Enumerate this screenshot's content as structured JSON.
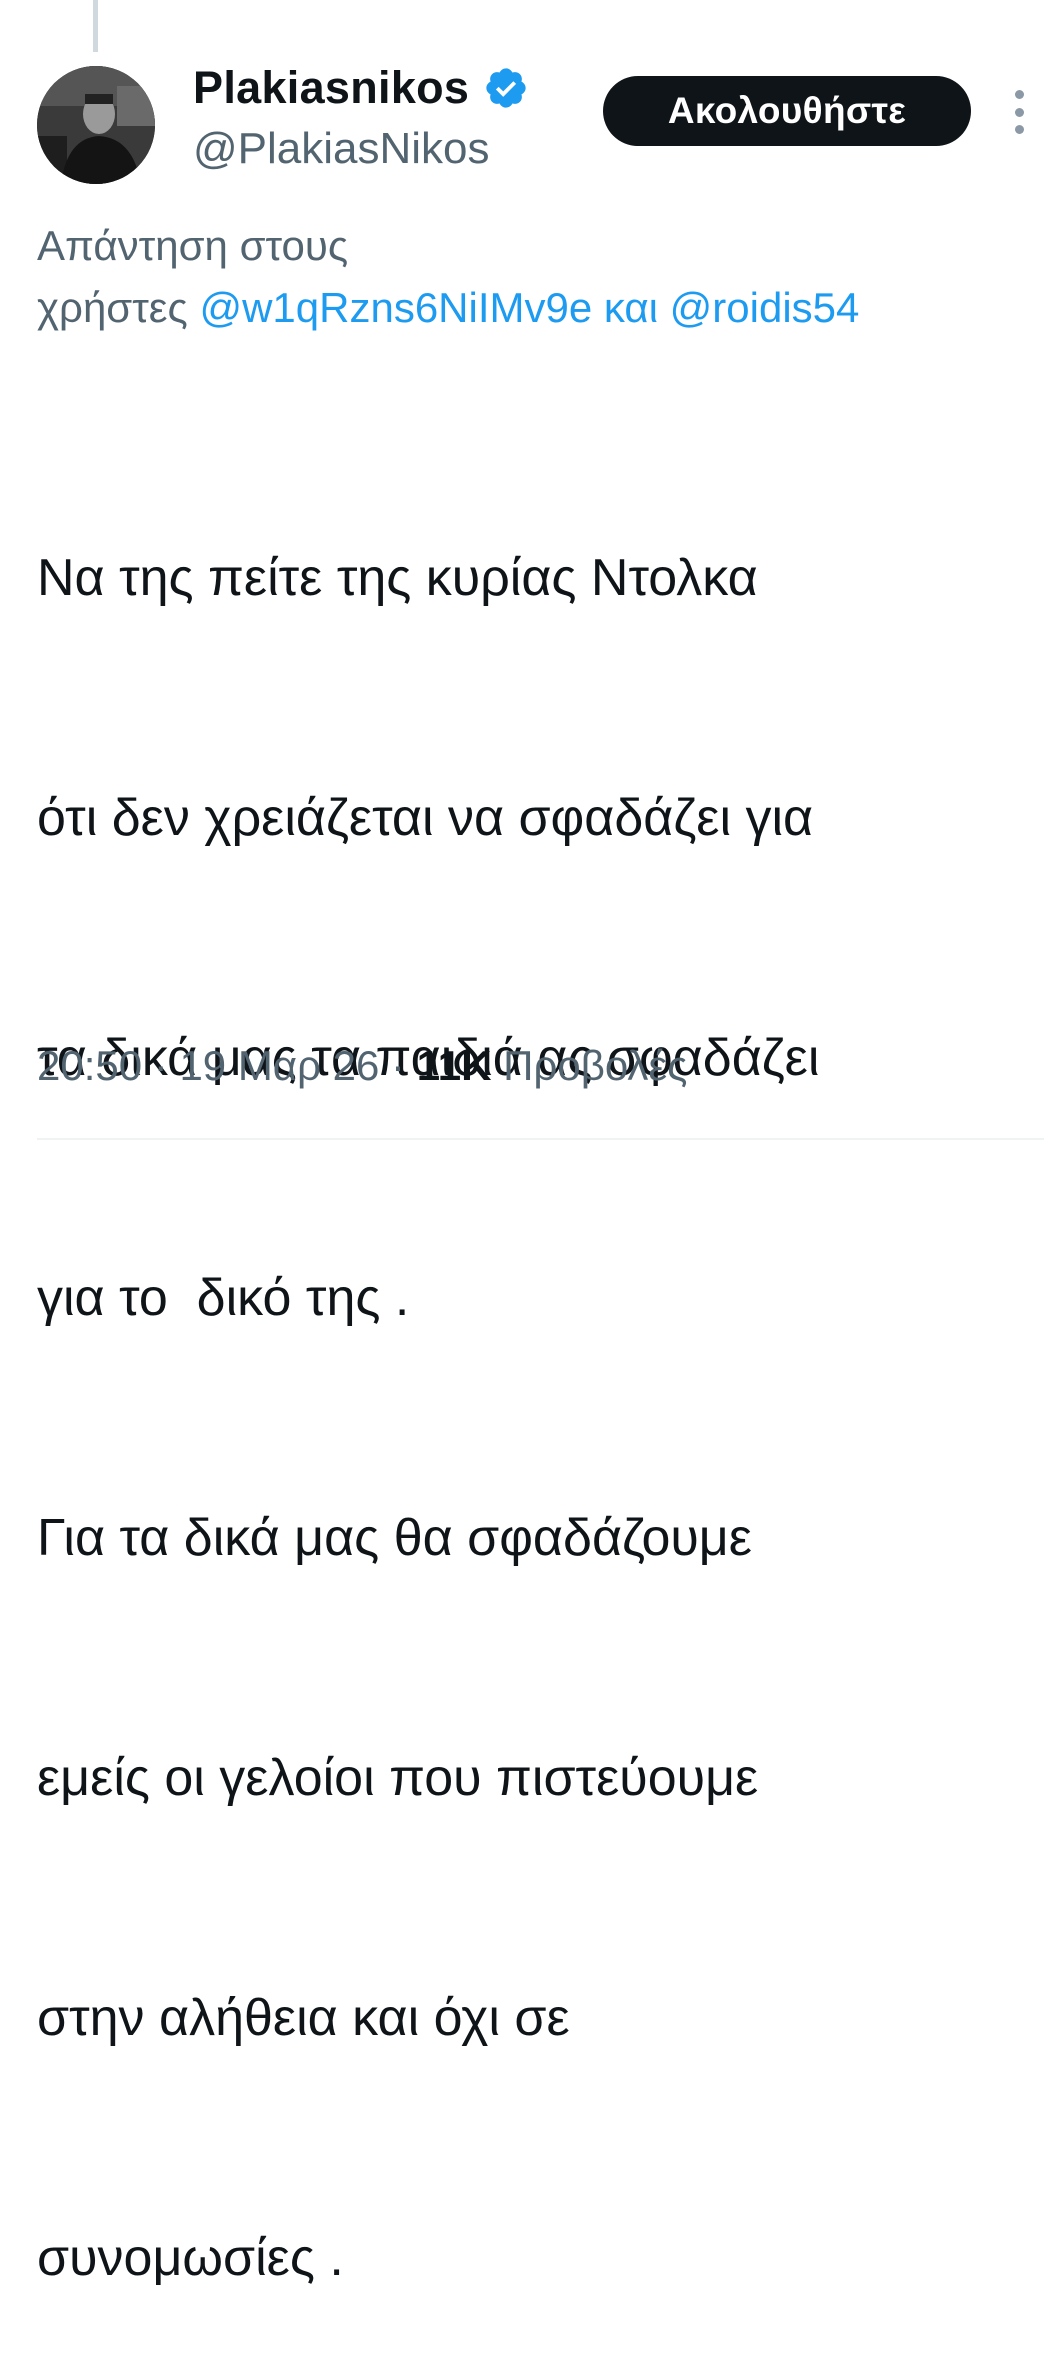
{
  "author": {
    "display_name": "Plakiasnikos",
    "handle": "@PlakiasNikos",
    "verified": true
  },
  "actions": {
    "follow_label": "Ακολουθήστε"
  },
  "reply_to": {
    "prefix_line1": "Απάντηση στους",
    "prefix_line2": "χρήστες ",
    "mention1": "@w1qRzns6NiIMv9e",
    "conjunction": " και ",
    "mention2": "@roidis54"
  },
  "tweet": {
    "lines": [
      "Να της πείτε της κυρίας Ντολκα",
      "ότι δεν χρειάζεται να σφαδάζει για",
      "τα δικά μας τα παιδιά ας σφαδάζει",
      "για το  δικό της .",
      "Για τα δικά μας θα σφαδάζουμε",
      "εμείς οι γελοίοι που πιστεύουμε",
      "στην αλήθεια και όχι σε",
      "συνομωσίες ."
    ]
  },
  "meta": {
    "time": "20:50",
    "separator": " · ",
    "date": "19 Μαρ 26",
    "views_count": "11K",
    "views_label": " Προβολές"
  },
  "colors": {
    "text_primary": "#0f1419",
    "text_secondary": "#536471",
    "link": "#1d9bf0",
    "verified_badge": "#1d9bf0",
    "follow_button_bg": "#0f1419",
    "follow_button_text": "#ffffff"
  },
  "icons": {
    "verified": "verified-badge-icon",
    "more": "more-options-icon"
  }
}
